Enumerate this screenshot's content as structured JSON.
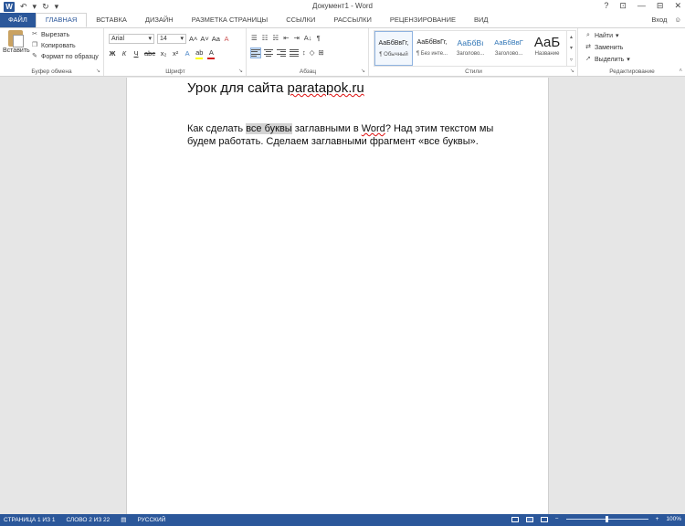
{
  "window": {
    "title": "Документ1 - Word",
    "app_logo": "W",
    "qat_undo": "↶",
    "qat_redo": "↻",
    "qat_more": "▾",
    "controls": {
      "help": "?",
      "restore_ribbon": "⊡",
      "minimize": "—",
      "maximize": "⊟",
      "close": "✕"
    }
  },
  "tabs": [
    {
      "label": "ФАЙЛ"
    },
    {
      "label": "ГЛАВНАЯ"
    },
    {
      "label": "ВСТАВКА"
    },
    {
      "label": "ДИЗАЙН"
    },
    {
      "label": "РАЗМЕТКА СТРАНИЦЫ"
    },
    {
      "label": "ССЫЛКИ"
    },
    {
      "label": "РАССЫЛКИ"
    },
    {
      "label": "РЕЦЕНЗИРОВАНИЕ"
    },
    {
      "label": "ВИД"
    }
  ],
  "signin": "Вход",
  "clipboard": {
    "paste": "Вставить",
    "cut": "Вырезать",
    "copy": "Копировать",
    "format_painter": "Формат по образцу",
    "label": "Буфер обмена"
  },
  "font": {
    "name": "Arial",
    "size": "14",
    "grow": "A˄",
    "shrink": "A˅",
    "case": "Aa",
    "clear": "A",
    "bold": "Ж",
    "italic": "К",
    "underline": "Ч",
    "strike": "abc",
    "subscript": "x₂",
    "superscript": "x²",
    "effects": "A",
    "highlight": "ab",
    "color": "A",
    "label": "Шрифт"
  },
  "paragraph": {
    "bullets": "☰",
    "numbering": "☷",
    "multilevel": "☵",
    "decrease_indent": "⇤",
    "increase_indent": "⇥",
    "sort": "A↓",
    "pilcrow": "¶",
    "shading": "◇",
    "borders": "⊞",
    "label": "Абзац"
  },
  "styles": {
    "items": [
      {
        "sample": "АаБбВвГг,",
        "name": "¶ Обычный"
      },
      {
        "sample": "АаБбВвГг,",
        "name": "¶ Без инте..."
      },
      {
        "sample": "АаБбВı",
        "name": "Заголово..."
      },
      {
        "sample": "АаБбВвГ",
        "name": "Заголово..."
      },
      {
        "sample": "АаБ",
        "name": "Название"
      }
    ],
    "label": "Стили"
  },
  "editing": {
    "find": "Найти",
    "replace": "Заменить",
    "select": "Выделить",
    "label": "Редактирование"
  },
  "document": {
    "title_prefix": "Урок для сайта ",
    "title_link": "paratapok.ru",
    "body_part1": "Как сделать ",
    "body_highlight": "все буквы",
    "body_part2": " заглавными в ",
    "body_word": "Word",
    "body_part3": "? Над этим текстом мы будем работать. Сделаем заглавными фрагмент «все буквы»."
  },
  "status": {
    "page": "СТРАНИЦА 1 ИЗ 1",
    "words": "СЛОВО 2 ИЗ 22",
    "language": "РУССКИЙ",
    "zoom_minus": "−",
    "zoom_plus": "+",
    "zoom": "100%",
    "zoom_fraction": 0.5
  },
  "colors": {
    "brand": "#2b579a",
    "selection": "#d3d3d3",
    "font_color": "#d11f1f",
    "highlight": "#ffff00"
  }
}
